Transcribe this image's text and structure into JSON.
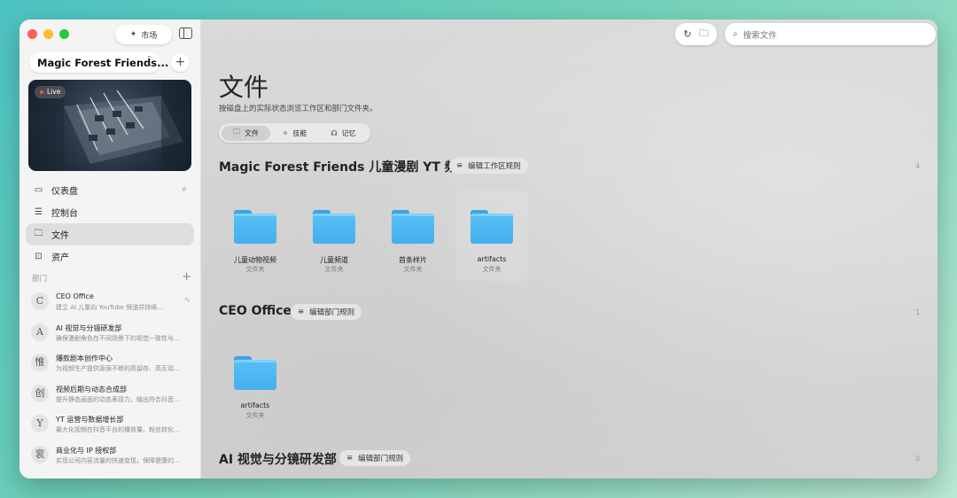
{
  "sidebar": {
    "market_label": "市场",
    "workspace_name": "Magic Forest Friends...",
    "live_label": "Live",
    "nav": [
      {
        "label": "仪表盘",
        "icon": "dashboard-icon"
      },
      {
        "label": "控制台",
        "icon": "list-icon"
      },
      {
        "label": "文件",
        "icon": "folder-icon"
      },
      {
        "label": "资产",
        "icon": "briefcase-icon"
      }
    ],
    "departments_header": "部门",
    "departments": [
      {
        "name": "CEO Office",
        "desc": "建立 AI 儿童向 YouTube 频道并持续...",
        "avatar": "C"
      },
      {
        "name": "AI 视觉与分镜研发部",
        "desc": "确保漫剧角色在不同场景下的视觉一致性与...",
        "avatar": "A"
      },
      {
        "name": "爆款剧本创作中心",
        "desc": "为视频生产提供源源不断的高留存、高互动...",
        "avatar": "惟"
      },
      {
        "name": "视频后期与动态合成部",
        "desc": "提升静态画面的动态表现力，输出符合抖音...",
        "avatar": "创"
      },
      {
        "name": "YT 运营与数据增长部",
        "desc": "最大化视频在抖音平台的播放量、粉丝转化...",
        "avatar": "Y"
      },
      {
        "name": "商业化与 IP 授权部",
        "desc": "实现公司内容流量的快速变现，保障健康的...",
        "avatar": "衮"
      }
    ]
  },
  "header": {
    "search_placeholder": "搜索文件"
  },
  "main": {
    "title": "文件",
    "subtitle": "按磁盘上的实际状态浏览工作区和部门文件夹。",
    "tabs": [
      {
        "label": "文件",
        "icon": "folder-icon"
      },
      {
        "label": "技能",
        "icon": "sparkle-icon"
      },
      {
        "label": "记忆",
        "icon": "brain-icon"
      }
    ],
    "sections": [
      {
        "title": "Magic Forest Friends 儿童漫剧 YT 频道",
        "rule_label": "编辑工作区规则",
        "count": "4",
        "folders": [
          {
            "name": "儿童动物视频",
            "type": "文件夹"
          },
          {
            "name": "儿童频道",
            "type": "文件夹"
          },
          {
            "name": "首条样片",
            "type": "文件夹"
          },
          {
            "name": "artifacts",
            "type": "文件夹"
          }
        ]
      },
      {
        "title": "CEO Office",
        "rule_label": "编辑部门规则",
        "count": "1",
        "folders": [
          {
            "name": "artifacts",
            "type": "文件夹"
          }
        ]
      },
      {
        "title": "AI 视觉与分镜研发部",
        "rule_label": "编辑部门规则",
        "count": "0",
        "folders": []
      }
    ]
  },
  "colors": {
    "folder_blue": "#4fb6f2",
    "live_dot": "#ff4a4a"
  }
}
